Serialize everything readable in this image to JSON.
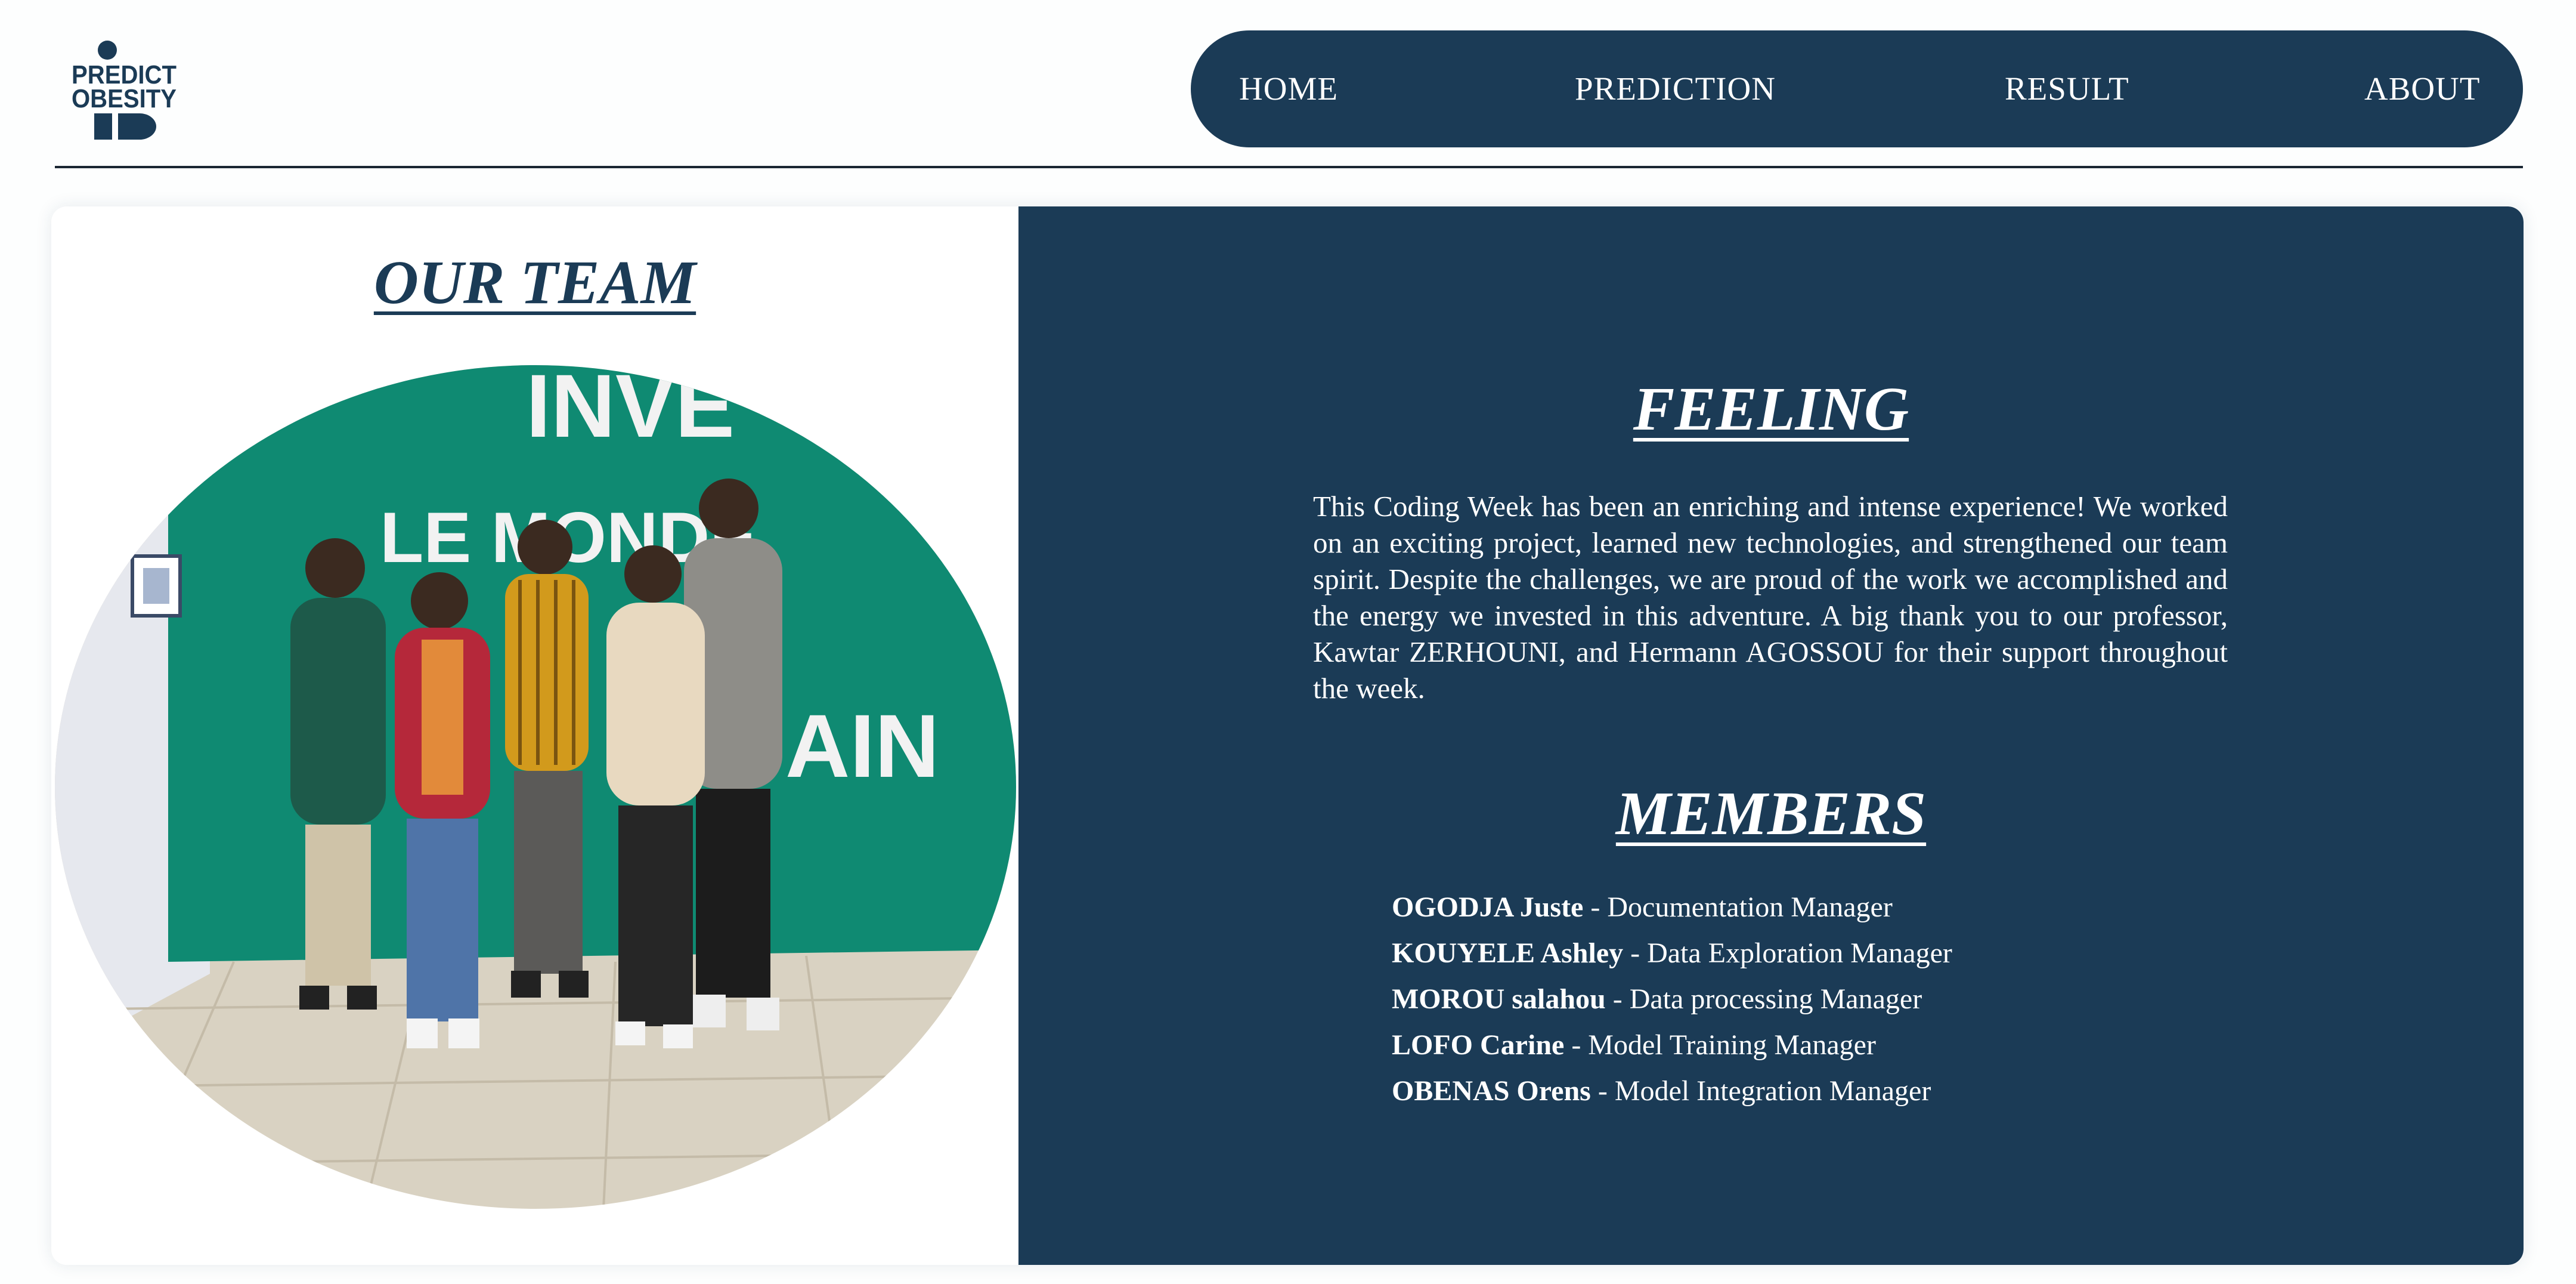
{
  "logo": {
    "line1": "PREDICT",
    "line2": "OBESITY",
    "color": "#1b3b56"
  },
  "nav": {
    "items": [
      {
        "label": "HOME"
      },
      {
        "label": "PREDICTION"
      },
      {
        "label": "RESULT"
      },
      {
        "label": "ABOUT"
      }
    ],
    "background": "#1b3b56"
  },
  "team": {
    "title": "OUR TEAM",
    "photo_wall_text": [
      "INVE",
      "LE MONDE",
      "AIN"
    ],
    "wall_color": "#0f8a72"
  },
  "feeling": {
    "title": "FEELING",
    "text": "This Coding Week has been an enriching and intense experience! We worked on an exciting project, learned new technologies, and strengthened our team spirit. Despite the challenges, we are proud of the work we accomplished and the energy we invested in this adventure. A big thank you to our professor, Kawtar ZERHOUNI, and Hermann AGOSSOU for their support throughout the week."
  },
  "members": {
    "title": "MEMBERS",
    "list": [
      {
        "name": "OGODJA Juste",
        "role": " - Documentation Manager"
      },
      {
        "name": "KOUYELE Ashley",
        "role": " - Data Exploration Manager"
      },
      {
        "name": "MOROU salahou",
        "role": " - Data processing Manager"
      },
      {
        "name": "LOFO Carine",
        "role": " - Model Training Manager"
      },
      {
        "name": "OBENAS Orens",
        "role": " - Model Integration Manager"
      }
    ]
  },
  "colors": {
    "primary": "#1b3b56",
    "text_on_primary": "#ffffff"
  }
}
